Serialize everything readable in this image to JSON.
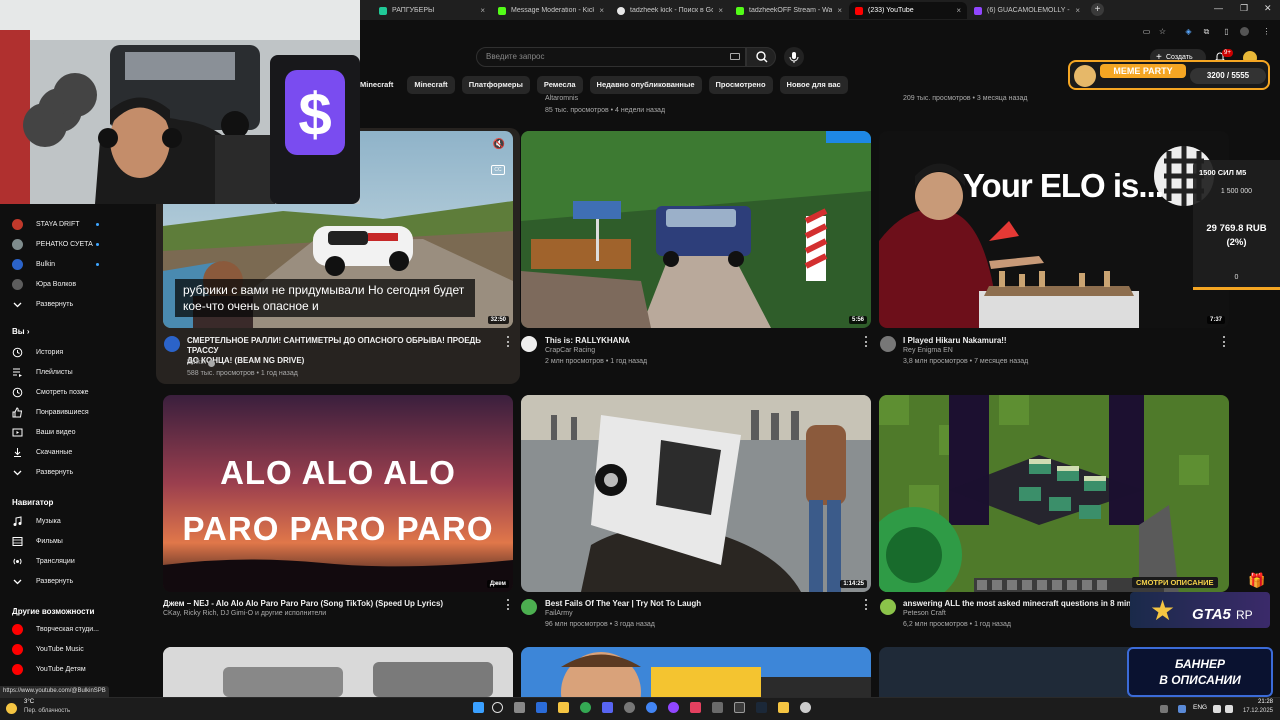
{
  "browser": {
    "tabs": [
      {
        "title": "РАПГУБЕРЫ",
        "color": "#20c997",
        "active": false
      },
      {
        "title": "Message Moderation - Kick Da",
        "color": "#53fc18",
        "active": false
      },
      {
        "title": "tadzheek kick - Поиск в Google",
        "color": "#e8e8e8",
        "active": false
      },
      {
        "title": "tadzheekOFF Stream - Watch L",
        "color": "#53fc18",
        "active": false
      },
      {
        "title": "(233) YouTube",
        "color": "#ff0000",
        "active": true
      },
      {
        "title": "(6) GUACAMOLEMOLLY - Twitch",
        "color": "#9146ff",
        "active": false
      }
    ],
    "new_tab": "+",
    "min": "—",
    "max": "❐",
    "close": "✕"
  },
  "header": {
    "search_placeholder": "Введите запрос",
    "create_label": "Создать",
    "notifications_count": "9+"
  },
  "chips": [
    "Minecraft",
    "Minecraft",
    "Платформеры",
    "Ремесла",
    "Недавно опубликованные",
    "Просмотрено",
    "Новое для вас"
  ],
  "top_row_meta": [
    {
      "channel": "Altaromnis",
      "meta": "85 тыс. просмотров • 4 недели назад"
    },
    {
      "meta": "209 тыс. просмотров • 3 месяца назад"
    }
  ],
  "sidebar": {
    "subscriptions": [
      {
        "label": "STAYA DRIFT",
        "color": "#c0392b",
        "dot": true
      },
      {
        "label": "РЕНАТКО СУЕТА",
        "color": "#7f8c8d",
        "dot": true
      },
      {
        "label": "Bulkin",
        "color": "#2b63c9",
        "dot": true
      },
      {
        "label": "Юра Волков",
        "color": "#5d5d5d",
        "dot": false
      }
    ],
    "expand1": "Развернуть",
    "you_heading": "Вы",
    "you_items": [
      "История",
      "Плейлисты",
      "Смотреть позже",
      "Понравившиеся",
      "Ваши видео",
      "Скачанные",
      "Развернуть"
    ],
    "navigator_heading": "Навигатор",
    "navigator_items": [
      "Музыка",
      "Фильмы",
      "Трансляции",
      "Развернуть"
    ],
    "other_heading": "Другие возможности",
    "other_items": [
      "Творческая студи...",
      "YouTube Music",
      "YouTube Детям"
    ]
  },
  "videos": [
    {
      "title_line1": "СМЕРТЕЛЬНОЕ РАЛЛИ! САНТИМЕТРЫ ДО ОПАСНОГО ОБРЫВА! ПРОЕДЬ ТРАССУ",
      "title_line2": "ДО КОНЦА! (BEAM NG DRIVE)",
      "channel": "Bulkin",
      "meta": "588 тыс. просмотров • 1 год назад",
      "duration": "32:50",
      "caption": "рубрики с вами не придумывали Но сегодня будет кое-что очень опасное и",
      "avatar": "#2b63c9"
    },
    {
      "title_line1": "This is: RALLYKHANA",
      "title_line2": "",
      "channel": "CrapCar Racing",
      "meta": "2 млн просмотров • 1 год назад",
      "duration": "5:56",
      "avatar": "#eeeeee"
    },
    {
      "title_line1": "I Played Hikaru Nakamura!!",
      "title_line2": "",
      "channel": "Rey Enigma EN",
      "meta": "3,8 млн просмотров • 7 месяцев назад",
      "duration": "7:37",
      "thumb_text": "Your ELO is...",
      "avatar": "#777777"
    },
    {
      "title_line1": "Джем – NEJ - Alo Alo Alo Paro Paro Paro (Song TikTok) (Speed Up Lyrics)",
      "title_line2": "",
      "channel": "CKay, Ricky Rich, DJ Gimi-O и другие исполнители",
      "meta": "",
      "duration": "Джем",
      "thumb_line1": "ALO ALO ALO",
      "thumb_line2": "PARO PARO PARO",
      "avatar": ""
    },
    {
      "title_line1": "Best Fails Of The Year | Try Not To Laugh",
      "title_line2": "",
      "channel": "FailArmy",
      "meta": "96 млн просмотров • 3 года назад",
      "duration": "1:14:25",
      "avatar": "#4caf50"
    },
    {
      "title_line1": "answering ALL the most asked minecraft questions in 8 minutes",
      "title_line2": "",
      "channel": "Peteson Craft",
      "meta": "6,2 млн просмотров • 1 год назад",
      "duration": "",
      "avatar": "#8bc34a"
    }
  ],
  "overlay": {
    "meme_party": "MEME PARTY",
    "counter": "3200 / 5555",
    "donation_title": "1500 СИЛ М5",
    "donation_goal": "1 500 000",
    "donation_amount": "29 769.8 RUB",
    "donation_percent": "(2%)",
    "donation_zero": "0",
    "gta_promo": "СМОТРИ ОПИСАНИЕ",
    "gta_label": "GTA5",
    "gta_rp": "RP",
    "banner_line1": "БАННЕР",
    "banner_line2": "В ОПИСАНИИ"
  },
  "status_bar_url": "https://www.youtube.com/@BulkinSPB",
  "taskbar": {
    "weather_temp": "3°C",
    "weather_desc": "Пер. облачность",
    "lang": "ENG",
    "time": "21:28",
    "date": "17.12.2025"
  }
}
